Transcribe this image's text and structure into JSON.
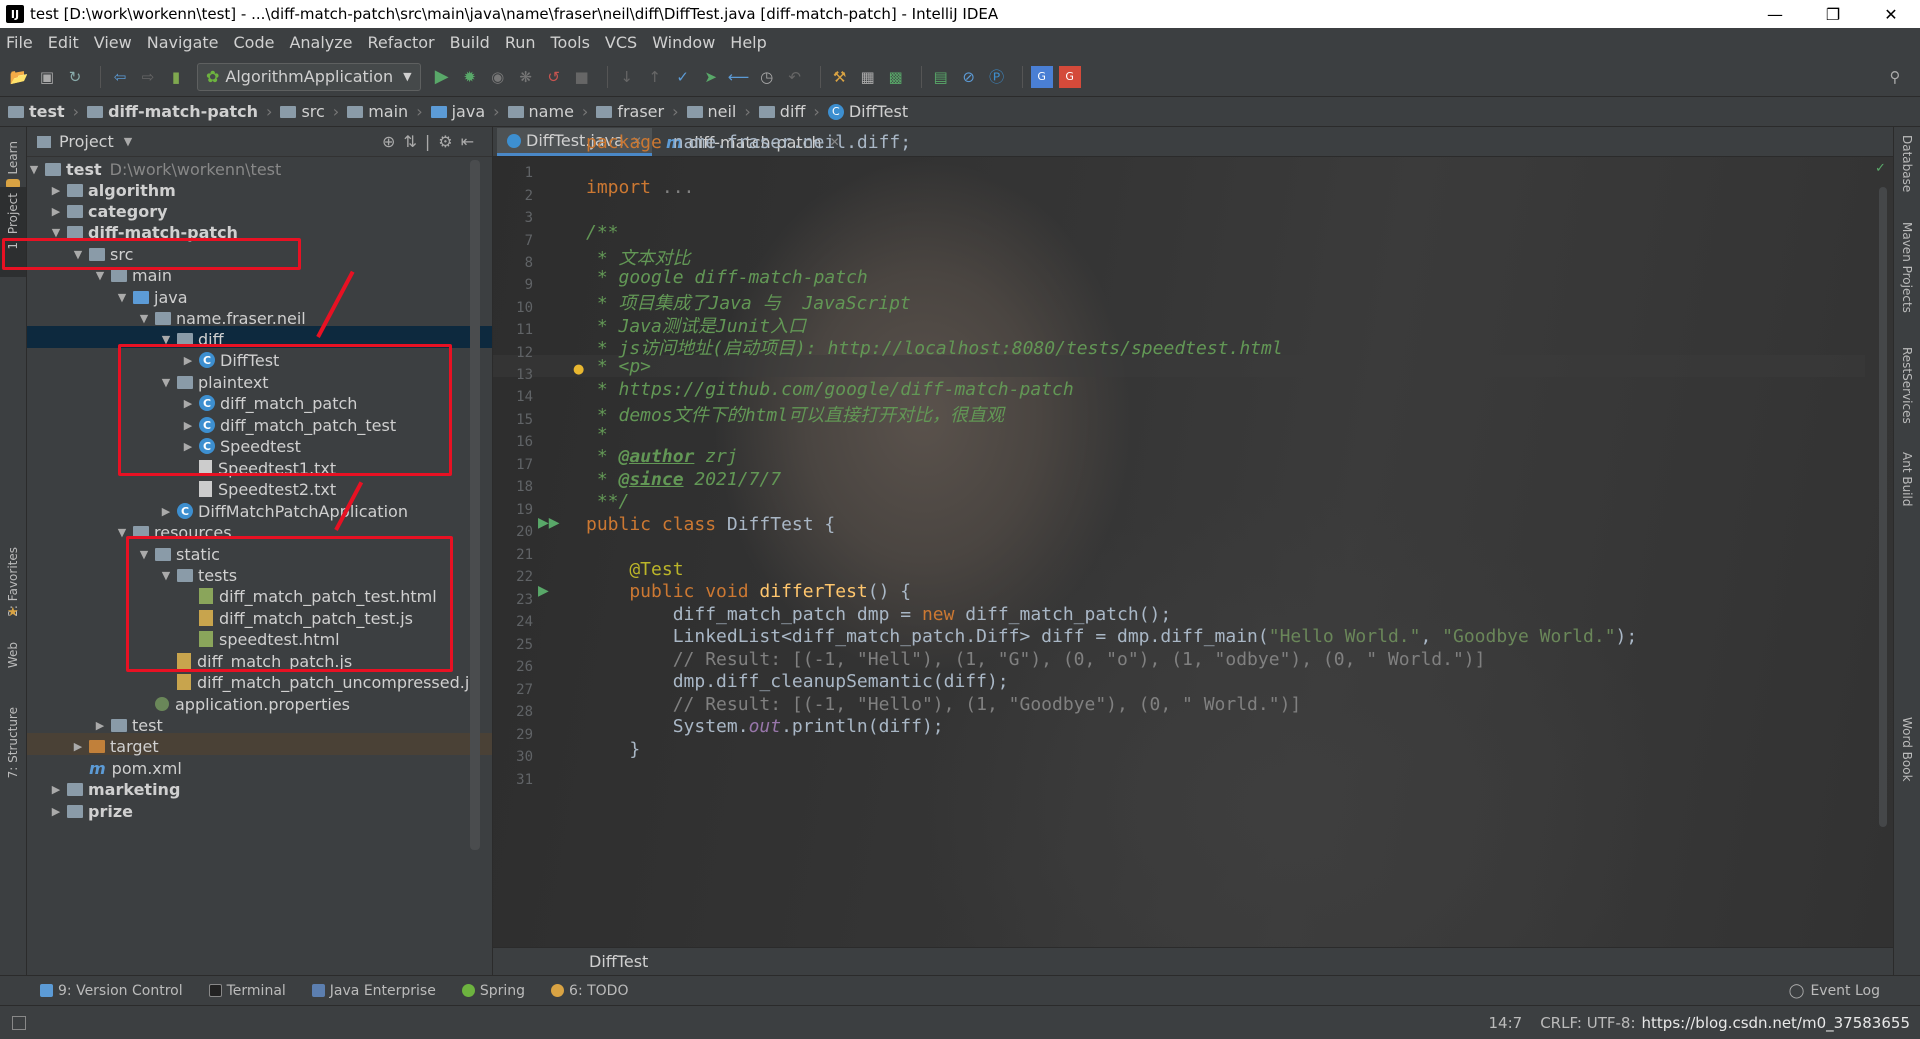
{
  "window": {
    "title": "test [D:\\work\\workenn\\test] - ...\\diff-match-patch\\src\\main\\java\\name\\fraser\\neil\\diff\\DiffTest.java [diff-match-patch] - IntelliJ IDEA"
  },
  "menu": [
    "File",
    "Edit",
    "View",
    "Navigate",
    "Code",
    "Analyze",
    "Refactor",
    "Build",
    "Run",
    "Tools",
    "VCS",
    "Window",
    "Help"
  ],
  "toolbar": {
    "run_config": "AlgorithmApplication"
  },
  "breadcrumbs": [
    "test",
    "diff-match-patch",
    "src",
    "main",
    "java",
    "name",
    "fraser",
    "neil",
    "diff",
    "DiffTest"
  ],
  "left_tabs": {
    "learn": "Learn",
    "project": "1: Project",
    "favorites": "2: Favorites",
    "web": "Web",
    "structure": "7: Structure"
  },
  "right_tabs": {
    "database": "Database",
    "maven": "Maven Projects",
    "rest": "RestServices",
    "ant": "Ant Build",
    "word": "Word Book"
  },
  "project_panel": {
    "title": "Project",
    "tree": [
      {
        "label": "test",
        "extra": "D:\\work\\workenn\\test"
      },
      {
        "label": "algorithm"
      },
      {
        "label": "category"
      },
      {
        "label": "diff-match-patch"
      },
      {
        "label": "src"
      },
      {
        "label": "main"
      },
      {
        "label": "java"
      },
      {
        "label": "name.fraser.neil"
      },
      {
        "label": "diff"
      },
      {
        "label": "DiffTest"
      },
      {
        "label": "plaintext"
      },
      {
        "label": "diff_match_patch"
      },
      {
        "label": "diff_match_patch_test"
      },
      {
        "label": "Speedtest"
      },
      {
        "label": "Speedtest1.txt"
      },
      {
        "label": "Speedtest2.txt"
      },
      {
        "label": "DiffMatchPatchApplication"
      },
      {
        "label": "resources"
      },
      {
        "label": "static"
      },
      {
        "label": "tests"
      },
      {
        "label": "diff_match_patch_test.html"
      },
      {
        "label": "diff_match_patch_test.js"
      },
      {
        "label": "speedtest.html"
      },
      {
        "label": "diff_match_patch.js"
      },
      {
        "label": "diff_match_patch_uncompressed.js"
      },
      {
        "label": "application.properties"
      },
      {
        "label": "test"
      },
      {
        "label": "target"
      },
      {
        "label": "pom.xml"
      },
      {
        "label": "marketing"
      },
      {
        "label": "prize"
      }
    ]
  },
  "editor": {
    "tabs": [
      "DiffTest.java",
      "diff-match-patch"
    ],
    "line_numbers": [
      "1",
      "2",
      "3",
      "7",
      "8",
      "9",
      "10",
      "11",
      "12",
      "13",
      "14",
      "15",
      "16",
      "17",
      "18",
      "19",
      "20",
      "21",
      "22",
      "23",
      "24",
      "25",
      "26",
      "27",
      "28",
      "29",
      "30",
      "31"
    ],
    "lines": {
      "l1a": "package",
      "l1b": " name.fraser.neil.diff;",
      "l3a": "import",
      "l3b": " ...",
      "l8": "/**",
      "l9": " * 文本对比",
      "l10": " * google diff-match-patch",
      "l11": " * 项目集成了Java 与  JavaScript",
      "l12": " * Java测试是Junit入口",
      "l13": " * js访问地址(启动项目): http://localhost:8080/tests/speedtest.html",
      "l14": " * <p>",
      "l15": " * https://github.com/google/diff-match-patch",
      "l16": " * demos文件下的html可以直接打开对比，很直观",
      "l17": " *",
      "l18a": " * ",
      "l18b": "@author",
      "l18c": " zrj",
      "l19a": " * ",
      "l19b": "@since",
      "l19c": " 2021/7/7",
      "l20": " **/",
      "l21a": "public class",
      "l21b": " DiffTest {",
      "l23": "    @Test",
      "l24a": "    public void ",
      "l24b": "differTest",
      "l24c": "() {",
      "l25a": "        diff_match_patch dmp = ",
      "l25b": "new",
      "l25c": " diff_match_patch();",
      "l26a": "        LinkedList<diff_match_patch.Diff> diff = dmp.diff_main(",
      "l26b": "\"Hello World.\"",
      "l26c": ", ",
      "l26d": "\"Goodbye World.\"",
      "l26e": ");",
      "l27": "        // Result: [(-1, \"Hell\"), (1, \"G\"), (0, \"o\"), (1, \"odbye\"), (0, \" World.\")]",
      "l28": "        dmp.diff_cleanupSemantic(diff);",
      "l29": "        // Result: [(-1, \"Hello\"), (1, \"Goodbye\"), (0, \" World.\")]",
      "l30a": "        System.",
      "l30b": "out",
      "l30c": ".println(diff);",
      "l31": "    }"
    },
    "footer": "DiffTest"
  },
  "bottom_tabs": [
    "9: Version Control",
    "Terminal",
    "Java Enterprise",
    "Spring",
    "6: TODO"
  ],
  "event_log": "Event Log",
  "status": {
    "position": "14:7",
    "encoding": "CRLF: UTF-8:",
    "url": "https://blog.csdn.net/m0_37583655"
  },
  "colors": {
    "annotation_red": "#e81123",
    "editor_bg": "#2f2f2f",
    "panel_bg": "#3c3f41"
  }
}
